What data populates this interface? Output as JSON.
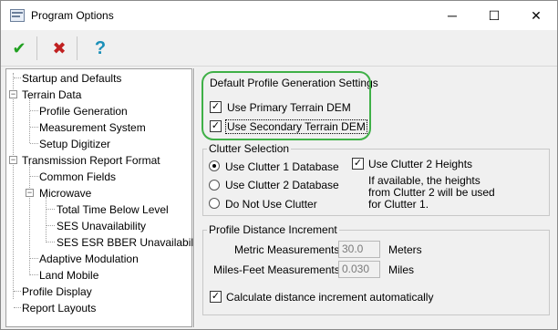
{
  "window": {
    "title": "Program Options",
    "minimize_icon": "─",
    "maximize_icon": "☐",
    "close_icon": "✕"
  },
  "toolbar": {
    "ok_icon": "✔",
    "cancel_icon": "✖",
    "help_icon": "?"
  },
  "tree": {
    "startup": "Startup and Defaults",
    "terrain": "Terrain Data",
    "profile_generation": "Profile Generation",
    "measurement_system": "Measurement System",
    "setup_digitizer": "Setup Digitizer",
    "transmission_format": "Transmission Report Format",
    "common_fields": "Common Fields",
    "microwave": "Microwave",
    "total_time_below": "Total Time Below Level",
    "ses_unavailability": "SES Unavailability",
    "ses_esr_bber": "SES ESR BBER Unavailability",
    "adaptive_modulation": "Adaptive Modulation",
    "land_mobile": "Land Mobile",
    "profile_display": "Profile Display",
    "report_layouts": "Report Layouts"
  },
  "settings": {
    "default_title": "Default Profile Generation Settings",
    "use_primary_dem": "Use Primary Terrain DEM",
    "use_secondary_dem": "Use Secondary Terrain DEM",
    "check_mark": "✓"
  },
  "clutter": {
    "title": "Clutter Selection",
    "use_clutter1": "Use Clutter 1 Database",
    "use_clutter2": "Use Clutter 2 Database",
    "no_clutter": "Do Not Use Clutter",
    "clutter2_heights": "Use Clutter 2 Heights",
    "note_line1": "If available, the heights",
    "note_line2": "from Clutter 2 will be used",
    "note_line3": "for Clutter 1."
  },
  "distance": {
    "title": "Profile Distance Increment",
    "metric_label": "Metric Measurements",
    "metric_value": "30.0",
    "metric_unit": "Meters",
    "miles_label": "Miles-Feet Measurements",
    "miles_value": "0.030",
    "miles_unit": "Miles",
    "auto_label": "Calculate distance increment automatically"
  }
}
